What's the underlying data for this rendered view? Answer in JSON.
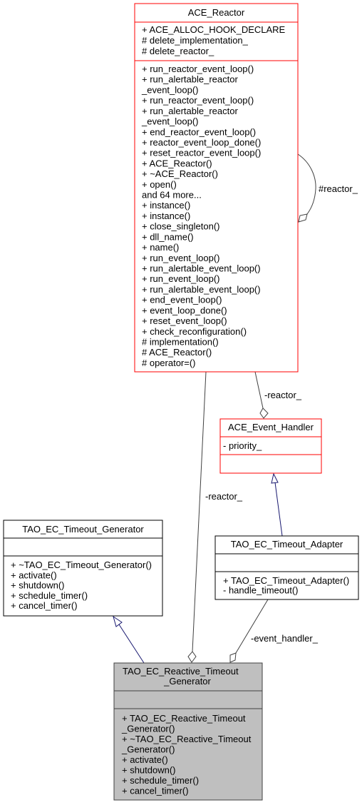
{
  "colors": {
    "external_class_border": "#ff0000",
    "class_border": "#000000",
    "focus_class_border": "#404040",
    "focus_class_fill": "#bfbfbf",
    "class_fill": "#ffffff",
    "usage_edge": "#404040",
    "inheritance_edge": "#191970"
  },
  "classes": {
    "ace_reactor": {
      "title": [
        "ACE_Reactor"
      ],
      "attributes": [
        "+ ACE_ALLOC_HOOK_DECLARE",
        "# delete_implementation_",
        "# delete_reactor_"
      ],
      "methods": [
        "+ run_reactor_event_loop()",
        "+ run_alertable_reactor",
        "_event_loop()",
        "+ run_reactor_event_loop()",
        "+ run_alertable_reactor",
        "_event_loop()",
        "+ end_reactor_event_loop()",
        "+ reactor_event_loop_done()",
        "+ reset_reactor_event_loop()",
        "+ ACE_Reactor()",
        "+ ~ACE_Reactor()",
        "+ open()",
        "and 64 more...",
        "+ instance()",
        "+ instance()",
        "+ close_singleton()",
        "+ dll_name()",
        "+ name()",
        "+ run_event_loop()",
        "+ run_alertable_event_loop()",
        "+ run_event_loop()",
        "+ run_alertable_event_loop()",
        "+ end_event_loop()",
        "+ event_loop_done()",
        "+ reset_event_loop()",
        "+ check_reconfiguration()",
        "# implementation()",
        "# ACE_Reactor()",
        "# operator=()"
      ]
    },
    "ace_event_handler": {
      "title": [
        "ACE_Event_Handler"
      ],
      "attributes": [
        "- priority_"
      ],
      "methods": []
    },
    "tao_ec_timeout_generator": {
      "title": [
        "TAO_EC_Timeout_Generator"
      ],
      "attributes": [],
      "methods": [
        "+ ~TAO_EC_Timeout_Generator()",
        "+ activate()",
        "+ shutdown()",
        "+ schedule_timer()",
        "+ cancel_timer()"
      ]
    },
    "tao_ec_timeout_adapter": {
      "title": [
        "TAO_EC_Timeout_Adapter"
      ],
      "attributes": [],
      "methods": [
        "+ TAO_EC_Timeout_Adapter()",
        "- handle_timeout()"
      ]
    },
    "tao_ec_reactive_timeout_generator": {
      "title": [
        "TAO_EC_Reactive_Timeout",
        "_Generator"
      ],
      "attributes": [],
      "methods": [
        "+ TAO_EC_Reactive_Timeout",
        "_Generator()",
        "+ ~TAO_EC_Reactive_Timeout",
        "_Generator()",
        "+ activate()",
        "+ shutdown()",
        "+ schedule_timer()",
        "+ cancel_timer()"
      ]
    }
  },
  "edges": {
    "reactor_self": {
      "label": "#reactor_",
      "kind": "composition"
    },
    "reactor_to_event_handler": {
      "label": "-reactor_",
      "kind": "composition"
    },
    "reactor_to_reactive_generator": {
      "label": "-reactor_",
      "kind": "composition"
    },
    "adapter_to_reactive_generator": {
      "label": "-event_handler_",
      "kind": "composition"
    },
    "adapter_inherits_event_handler": {
      "kind": "inheritance"
    },
    "reactive_inherits_timeout_generator": {
      "kind": "inheritance"
    }
  }
}
